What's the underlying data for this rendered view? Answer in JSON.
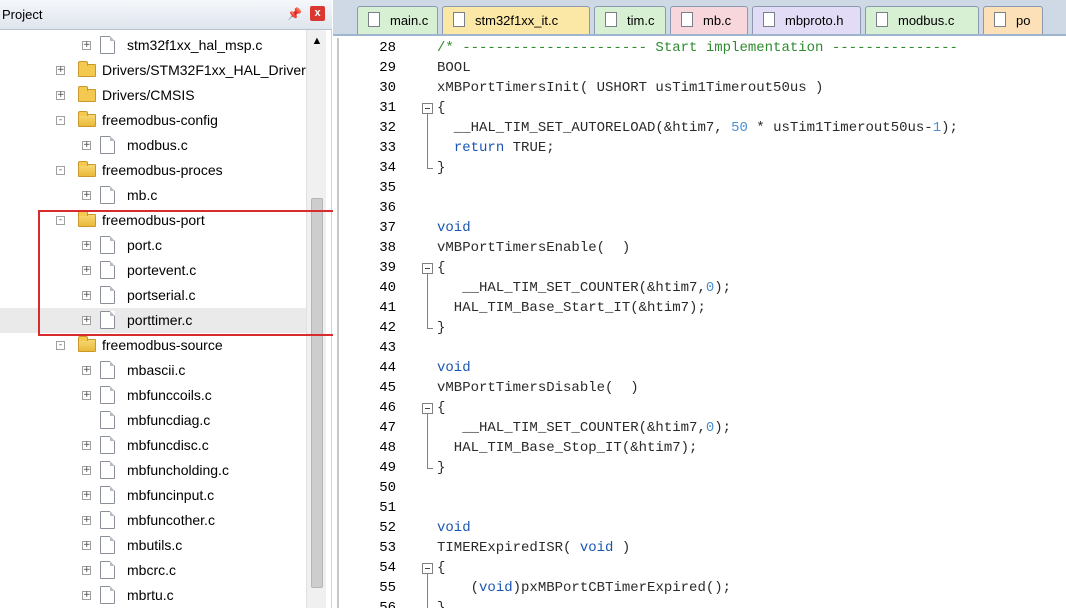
{
  "project_panel": {
    "title": "Project",
    "pin_icon": "pin-icon",
    "close_glyph": "x",
    "tree": [
      {
        "label": "stm32f1xx_hal_msp.c",
        "type": "file",
        "indent": 1,
        "expander": "+"
      },
      {
        "label": "Drivers/STM32F1xx_HAL_Driver",
        "type": "folder",
        "indent": 0,
        "expander": "+"
      },
      {
        "label": "Drivers/CMSIS",
        "type": "folder",
        "indent": 0,
        "expander": "+"
      },
      {
        "label": "freemodbus-config",
        "type": "folder-open",
        "indent": 0,
        "expander": "-"
      },
      {
        "label": "modbus.c",
        "type": "file",
        "indent": 1,
        "expander": "+"
      },
      {
        "label": "freemodbus-proces",
        "type": "folder-open",
        "indent": 0,
        "expander": "-"
      },
      {
        "label": "mb.c",
        "type": "file",
        "indent": 1,
        "expander": "+"
      },
      {
        "label": "freemodbus-port",
        "type": "folder-open",
        "indent": 0,
        "expander": "-"
      },
      {
        "label": "port.c",
        "type": "file",
        "indent": 1,
        "expander": "+"
      },
      {
        "label": "portevent.c",
        "type": "file",
        "indent": 1,
        "expander": "+"
      },
      {
        "label": "portserial.c",
        "type": "file",
        "indent": 1,
        "expander": "+"
      },
      {
        "label": "porttimer.c",
        "type": "file",
        "indent": 1,
        "expander": "+",
        "selected": true
      },
      {
        "label": "freemodbus-source",
        "type": "folder-open",
        "indent": 0,
        "expander": "-"
      },
      {
        "label": "mbascii.c",
        "type": "file",
        "indent": 1,
        "expander": "+"
      },
      {
        "label": "mbfunccoils.c",
        "type": "file",
        "indent": 1,
        "expander": "+"
      },
      {
        "label": "mbfuncdiag.c",
        "type": "file",
        "indent": 1,
        "expander": ""
      },
      {
        "label": "mbfuncdisc.c",
        "type": "file",
        "indent": 1,
        "expander": "+"
      },
      {
        "label": "mbfuncholding.c",
        "type": "file",
        "indent": 1,
        "expander": "+"
      },
      {
        "label": "mbfuncinput.c",
        "type": "file",
        "indent": 1,
        "expander": "+"
      },
      {
        "label": "mbfuncother.c",
        "type": "file",
        "indent": 1,
        "expander": "+"
      },
      {
        "label": "mbutils.c",
        "type": "file",
        "indent": 1,
        "expander": "+"
      },
      {
        "label": "mbcrc.c",
        "type": "file",
        "indent": 1,
        "expander": "+"
      },
      {
        "label": "mbrtu.c",
        "type": "file",
        "indent": 1,
        "expander": "+"
      }
    ],
    "scroll_up_glyph": "▲"
  },
  "editor": {
    "tabs": [
      {
        "label": "main.c",
        "color": "#d7efd2"
      },
      {
        "label": "stm32f1xx_it.c",
        "color": "#fbe7a6"
      },
      {
        "label": "tim.c",
        "color": "#d7efd2"
      },
      {
        "label": "mb.c",
        "color": "#f7d6dc"
      },
      {
        "label": "mbproto.h",
        "color": "#e3dcf6"
      },
      {
        "label": "modbus.c",
        "color": "#d7efd2"
      },
      {
        "label": "po",
        "color": "#fbe0b8"
      }
    ],
    "lines": [
      {
        "n": "28",
        "parts": [
          [
            "cmt",
            "/* ---------------------- Start implementation ---------------"
          ]
        ]
      },
      {
        "n": "29",
        "parts": [
          [
            "",
            "BOOL"
          ]
        ]
      },
      {
        "n": "30",
        "parts": [
          [
            "",
            "xMBPortTimersInit( USHORT usTim1Timerout50us )"
          ]
        ]
      },
      {
        "n": "31",
        "fold": true,
        "parts": [
          [
            "",
            "{"
          ]
        ]
      },
      {
        "n": "32",
        "parts": [
          [
            "",
            "  __HAL_TIM_SET_AUTORELOAD(&htim7, "
          ],
          [
            "num",
            "50"
          ],
          [
            "",
            " * usTim1Timerout50us-"
          ],
          [
            "num",
            "1"
          ],
          [
            "",
            ");"
          ]
        ]
      },
      {
        "n": "33",
        "parts": [
          [
            "",
            "  "
          ],
          [
            "kw",
            "return"
          ],
          [
            "",
            " TRUE;"
          ]
        ]
      },
      {
        "n": "34",
        "parts": [
          [
            "",
            "}"
          ]
        ]
      },
      {
        "n": "35",
        "parts": [
          [
            "",
            ""
          ]
        ]
      },
      {
        "n": "36",
        "parts": [
          [
            "",
            ""
          ]
        ]
      },
      {
        "n": "37",
        "parts": [
          [
            "kw",
            "void"
          ]
        ]
      },
      {
        "n": "38",
        "parts": [
          [
            "",
            "vMBPortTimersEnable(  )"
          ]
        ]
      },
      {
        "n": "39",
        "fold": true,
        "parts": [
          [
            "",
            "{"
          ]
        ]
      },
      {
        "n": "40",
        "parts": [
          [
            "",
            "   __HAL_TIM_SET_COUNTER(&htim7,"
          ],
          [
            "num",
            "0"
          ],
          [
            "",
            ");"
          ]
        ]
      },
      {
        "n": "41",
        "parts": [
          [
            "",
            "  HAL_TIM_Base_Start_IT(&htim7);"
          ]
        ]
      },
      {
        "n": "42",
        "parts": [
          [
            "",
            "}"
          ]
        ]
      },
      {
        "n": "43",
        "parts": [
          [
            "",
            ""
          ]
        ]
      },
      {
        "n": "44",
        "parts": [
          [
            "kw",
            "void"
          ]
        ]
      },
      {
        "n": "45",
        "parts": [
          [
            "",
            "vMBPortTimersDisable(  )"
          ]
        ]
      },
      {
        "n": "46",
        "fold": true,
        "parts": [
          [
            "",
            "{"
          ]
        ]
      },
      {
        "n": "47",
        "parts": [
          [
            "",
            "   __HAL_TIM_SET_COUNTER(&htim7,"
          ],
          [
            "num",
            "0"
          ],
          [
            "",
            ");"
          ]
        ]
      },
      {
        "n": "48",
        "parts": [
          [
            "",
            "  HAL_TIM_Base_Stop_IT(&htim7);"
          ]
        ]
      },
      {
        "n": "49",
        "parts": [
          [
            "",
            "}"
          ]
        ]
      },
      {
        "n": "50",
        "parts": [
          [
            "",
            ""
          ]
        ]
      },
      {
        "n": "51",
        "parts": [
          [
            "",
            ""
          ]
        ]
      },
      {
        "n": "52",
        "parts": [
          [
            "kw",
            "void"
          ]
        ]
      },
      {
        "n": "53",
        "parts": [
          [
            "",
            "TIMERExpiredISR( "
          ],
          [
            "kw",
            "void"
          ],
          [
            "",
            " )"
          ]
        ]
      },
      {
        "n": "54",
        "fold": true,
        "parts": [
          [
            "",
            "{"
          ]
        ]
      },
      {
        "n": "55",
        "parts": [
          [
            "",
            "    ("
          ],
          [
            "kw",
            "void"
          ],
          [
            "",
            ")pxMBPortCBTimerExpired();"
          ]
        ]
      },
      {
        "n": "56",
        "parts": [
          [
            "",
            "}"
          ]
        ]
      }
    ]
  },
  "colors": {
    "highlight_box": "#d82b2b",
    "keyword": "#1a55b4",
    "comment": "#2e8b2e",
    "number": "#4a8fd4"
  }
}
